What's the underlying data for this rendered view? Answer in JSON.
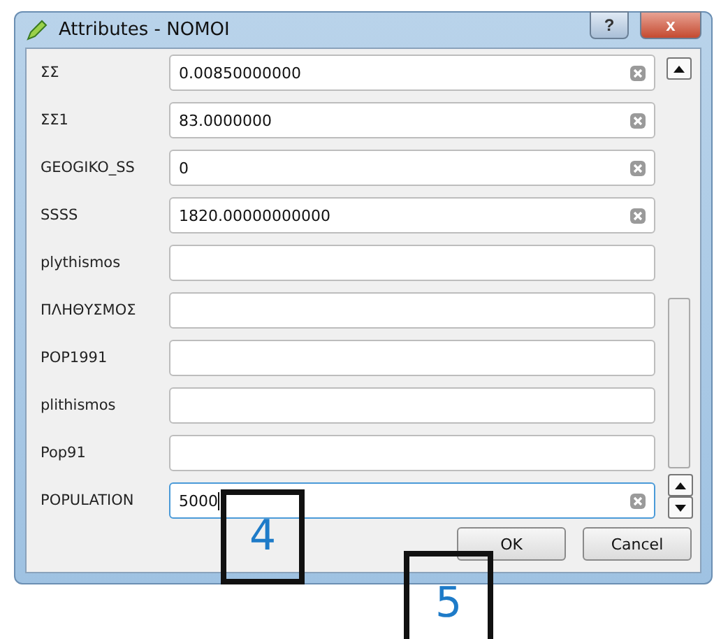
{
  "window": {
    "title": "Attributes - NOMOI",
    "help_button": "?",
    "close_button": "x"
  },
  "fields": [
    {
      "label": "ΣΣ",
      "value": "0.00850000000",
      "focused": false
    },
    {
      "label": "ΣΣ1",
      "value": "83.0000000",
      "focused": false
    },
    {
      "label": "GEOGIKO_SS",
      "value": "0",
      "focused": false
    },
    {
      "label": "SSSS",
      "value": "1820.00000000000",
      "focused": false
    },
    {
      "label": "plythismos",
      "focused": false
    },
    {
      "label": "ΠΛΗΘΥΣΜΟΣ",
      "focused": false
    },
    {
      "label": "POP1991",
      "focused": false
    },
    {
      "label": "plithismos",
      "focused": false
    },
    {
      "label": "Pop91",
      "focused": false
    },
    {
      "label": "POPULATION",
      "value": "5000",
      "focused": true
    }
  ],
  "buttons": [
    "OK",
    "Cancel"
  ],
  "callouts": [
    {
      "label": "4"
    },
    {
      "label": "5"
    }
  ]
}
